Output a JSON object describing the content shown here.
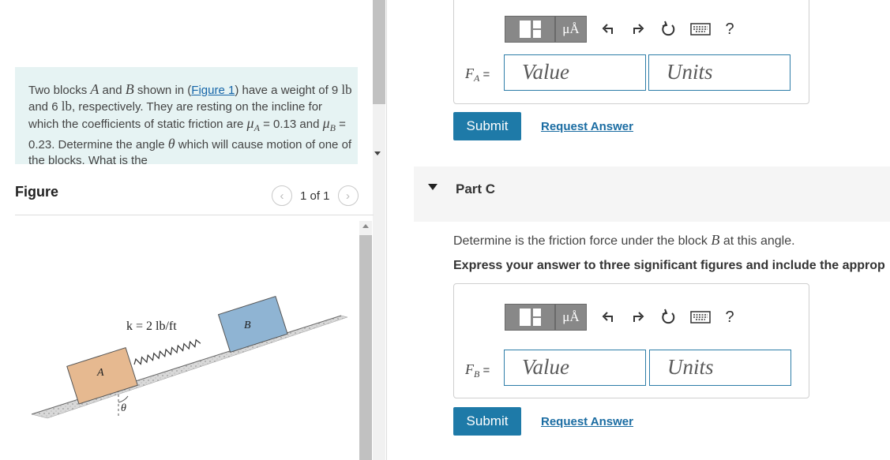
{
  "problem": {
    "intro": "Two blocks ",
    "blockA": "A",
    "and1": " and ",
    "blockB": "B",
    "shown_in": " shown in (",
    "figure_link": "Figure 1",
    "weight_text": ") have a weight of 9 ",
    "unit_lb1": "lb",
    "and2": " and 6 ",
    "unit_lb2": "lb",
    "resting": ", respectively. They are resting on the incline for which the coefficients of static friction are ",
    "muA": "μ",
    "muA_sub": "A",
    "eq1": " = 0.13 and ",
    "muB": "μ",
    "muB_sub": "B",
    "eq2": " = 0.23. Determine the angle ",
    "theta": "θ",
    "rest": " which will cause motion of one of the blocks. What is the"
  },
  "figure_panel": {
    "title": "Figure",
    "prev_icon": "‹",
    "next_icon": "›",
    "pager_text": "1 of 1"
  },
  "figure": {
    "spring_label": "k = 2 lb/ft",
    "block_a_label": "A",
    "block_b_label": "B",
    "angle_label": "θ"
  },
  "toolbar": {
    "units_label": "μÅ",
    "help_label": "?"
  },
  "part_b": {
    "var": "F",
    "sub": "A",
    "eq": " =",
    "value_placeholder": "Value",
    "units_placeholder": "Units",
    "submit_label": "Submit",
    "request_label": "Request Answer"
  },
  "part_c": {
    "title": "Part C",
    "question_pre": "Determine is the friction force under the block ",
    "question_var": "B",
    "question_post": " at this angle.",
    "instruction": "Express your answer to three significant figures and include the approp",
    "var": "F",
    "sub": "B",
    "eq": " =",
    "value_placeholder": "Value",
    "units_placeholder": "Units",
    "submit_label": "Submit",
    "request_label": "Request Answer"
  },
  "colors": {
    "accent": "#1e7aa8",
    "problem_bg": "#e6f3f3",
    "block_a": "#e6b990",
    "block_b": "#8fb4d3"
  }
}
